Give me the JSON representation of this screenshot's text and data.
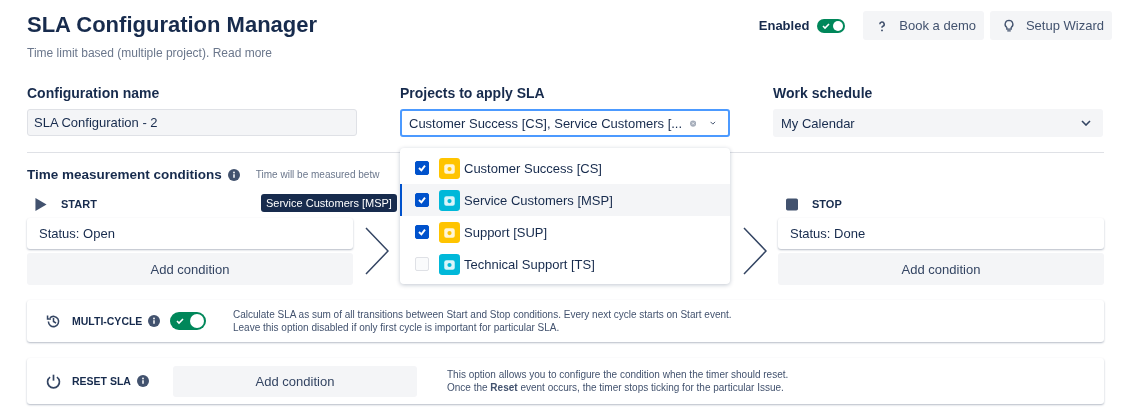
{
  "header": {
    "title": "SLA Configuration Manager",
    "subtitle": "Time limit based (multiple project).",
    "subtitle_link": "Read more",
    "enabled": {
      "label": "Enabled",
      "on": true
    },
    "buttons": [
      {
        "label": "Book a demo",
        "kind": "help"
      },
      {
        "label": "Setup Wizard",
        "kind": "bulb"
      }
    ]
  },
  "config_name": {
    "label": "Configuration name",
    "value": "SLA Configuration - 2"
  },
  "projects": {
    "label": "Projects to apply SLA",
    "value": "Customer Success [CS], Service Customers [...",
    "options": [
      {
        "label": "Customer Success [CS]",
        "checked": true,
        "selected": false,
        "color": "#ffc400"
      },
      {
        "label": "Service Customers [MSP]",
        "checked": true,
        "selected": true,
        "color": "#00b8d9"
      },
      {
        "label": "Support [SUP]",
        "checked": true,
        "selected": false,
        "color": "#ffc400"
      },
      {
        "label": "Technical Support [TS]",
        "checked": false,
        "selected": false,
        "color": "#00b8d9"
      }
    ]
  },
  "work_schedule": {
    "label": "Work schedule",
    "value": "My Calendar"
  },
  "time_measurement": {
    "title": "Time measurement conditions",
    "note": "Time will be measured betw",
    "tooltip": "Service Customers [MSP]",
    "start": {
      "label": "START",
      "condition": "Status: Open",
      "button": "Add condition"
    },
    "stop": {
      "label": "STOP",
      "condition": "Status: Done",
      "button": "Add condition"
    }
  },
  "multi_cycle": {
    "label": "MULTI-CYCLE",
    "on": true,
    "lines": [
      "Calculate SLA as sum of all transitions between Start and Stop conditions. Every next cycle starts on Start event.",
      "Leave this option disabled if only first cycle is important for particular SLA."
    ]
  },
  "reset": {
    "label": "RESET SLA",
    "button": "Add condition",
    "lines": [
      "This option allows you to configure the condition when the timer should reset.",
      "Once the **Reset** event occurs, the timer stops ticking for the particular Issue."
    ]
  }
}
